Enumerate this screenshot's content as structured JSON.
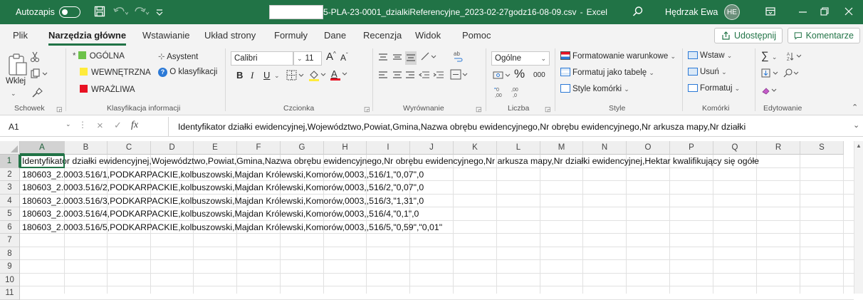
{
  "titlebar": {
    "autosave_label": "Autozapis",
    "filename": "5-PLA-23-0001_dzialkiReferencyjne_2023-02-27godz16-08-09.csv",
    "separator": "-",
    "app_name": "Excel",
    "user_name": "Hędrzak Ewa",
    "user_initials": "HE",
    "accent_color": "#217346"
  },
  "menu": {
    "tabs": [
      "Plik",
      "Narzędzia główne",
      "Wstawianie",
      "Układ strony",
      "Formuły",
      "Dane",
      "Recenzja",
      "Widok",
      "Pomoc"
    ],
    "active_tab": "Narzędzia główne",
    "share_label": "Udostępnij",
    "comments_label": "Komentarze"
  },
  "ribbon": {
    "clipboard": {
      "paste_label": "Wklej",
      "group_label": "Schowek"
    },
    "classification": {
      "general": "OGÓLNA",
      "internal": "WEWNĘTRZNA",
      "sensitive": "WRAŻLIWA",
      "assistant": "Asystent",
      "about": "O klasyfikacji",
      "group_label": "Klasyfikacja informacji",
      "colors": {
        "general": "#6cc24a",
        "internal": "#ffeb3b",
        "sensitive": "#e81123"
      }
    },
    "font": {
      "font_name": "Calibri",
      "font_size": "11",
      "bold": "B",
      "italic": "I",
      "underline": "U",
      "grow": "A",
      "shrink": "A",
      "group_label": "Czcionka"
    },
    "alignment": {
      "group_label": "Wyrównanie"
    },
    "number": {
      "format": "Ogólne",
      "percent": "%",
      "thousands": "000",
      "group_label": "Liczba"
    },
    "styles": {
      "conditional": "Formatowanie warunkowe",
      "as_table": "Formatuj jako tabelę",
      "cell_styles": "Style komórki",
      "group_label": "Style"
    },
    "cells": {
      "insert": "Wstaw",
      "delete": "Usuń",
      "format": "Formatuj",
      "group_label": "Komórki"
    },
    "editing": {
      "group_label": "Edytowanie"
    }
  },
  "formula_bar": {
    "cell_ref": "A1",
    "fx": "fx",
    "content": "Identyfikator działki ewidencyjnej,Województwo,Powiat,Gmina,Nazwa obrębu ewidencyjnego,Nr obrębu ewidencyjnego,Nr arkusza mapy,Nr działki"
  },
  "grid": {
    "columns": [
      "A",
      "B",
      "C",
      "D",
      "E",
      "F",
      "G",
      "H",
      "I",
      "J",
      "K",
      "L",
      "M",
      "N",
      "O",
      "P",
      "Q",
      "R",
      "S"
    ],
    "selected_column": "A",
    "rows": [
      "1",
      "2",
      "3",
      "4",
      "5",
      "6",
      "7",
      "8",
      "9",
      "10",
      "11"
    ],
    "selected_row": "1",
    "cells": [
      "Identyfikator działki ewidencyjnej,Województwo,Powiat,Gmina,Nazwa obrębu ewidencyjnego,Nr obrębu ewidencyjnego,Nr arkusza mapy,Nr działki ewidencyjnej,Hektar kwalifikujący się ogółe",
      "180603_2.0003.516/1,PODKARPACKIE,kolbuszowski,Majdan Królewski,Komorów,0003,,516/1,\"0,07\",0",
      "180603_2.0003.516/2,PODKARPACKIE,kolbuszowski,Majdan Królewski,Komorów,0003,,516/2,\"0,07\",0",
      "180603_2.0003.516/3,PODKARPACKIE,kolbuszowski,Majdan Królewski,Komorów,0003,,516/3,\"1,31\",0",
      "180603_2.0003.516/4,PODKARPACKIE,kolbuszowski,Majdan Królewski,Komorów,0003,,516/4,\"0,1\",0",
      "180603_2.0003.516/5,PODKARPACKIE,kolbuszowski,Majdan Królewski,Komorów,0003,,516/5,\"0,59\",\"0,01\""
    ]
  }
}
